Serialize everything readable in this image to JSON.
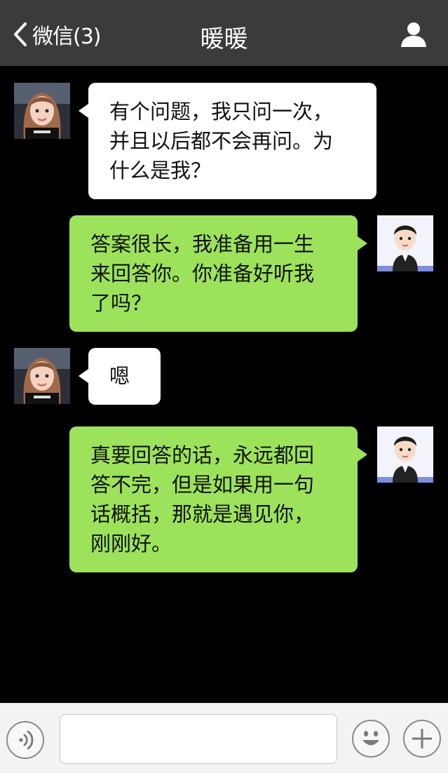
{
  "header": {
    "back_label": "微信(3)",
    "title": "暖暖"
  },
  "messages": [
    {
      "side": "left",
      "sender": "暖暖",
      "text_lines": [
        "有个问题，我只问一次，",
        "并且以后都不会再问。为",
        "什么是我？"
      ]
    },
    {
      "side": "right",
      "sender": "me",
      "text_lines": [
        "答案很长，我准备用一生",
        "来回答你。你准备好听我",
        "了吗？"
      ]
    },
    {
      "side": "left",
      "sender": "暖暖",
      "text_lines": [
        "嗯"
      ]
    },
    {
      "side": "right",
      "sender": "me",
      "text_lines": [
        "真要回答的话，永远都回",
        "答不完，但是如果用一句",
        "话概括，那就是遇见你，",
        "刚刚好。"
      ]
    }
  ],
  "input": {
    "value": "",
    "placeholder": ""
  },
  "icons": {
    "back": "chevron-left-icon",
    "profile": "person-icon",
    "voice": "voice-icon",
    "emoji": "smiley-icon",
    "plus": "plus-icon"
  },
  "colors": {
    "header_bg": "#3b3b3d",
    "chat_bg": "#000000",
    "received_bubble": "#ffffff",
    "sent_bubble": "#9ce35b"
  }
}
